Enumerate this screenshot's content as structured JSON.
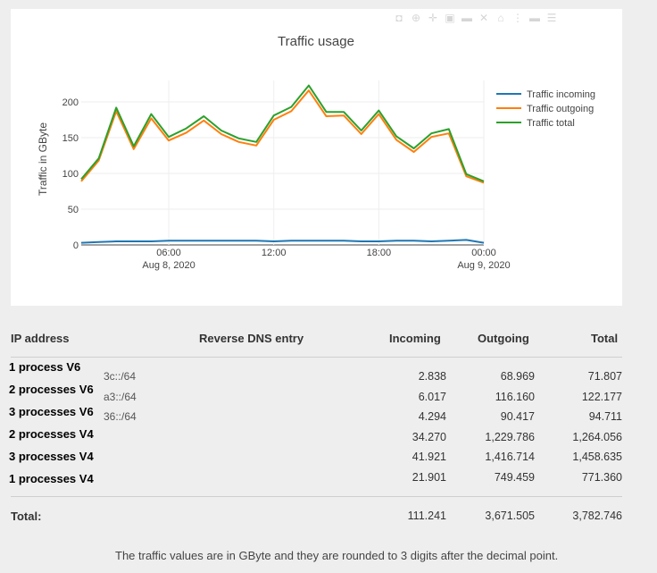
{
  "chart_data": {
    "type": "line",
    "title": "Traffic usage",
    "ylabel": "Traffic in GByte",
    "ylim": [
      0,
      230
    ],
    "yticks": [
      0,
      50,
      100,
      150,
      200
    ],
    "xlim": [
      "2020-08-08 01:00",
      "2020-08-09 00:00"
    ],
    "xticks": [
      {
        "x": "2020-08-08 06:00",
        "label": "06:00",
        "sublabel": "Aug 8, 2020"
      },
      {
        "x": "2020-08-08 12:00",
        "label": "12:00",
        "sublabel": ""
      },
      {
        "x": "2020-08-08 18:00",
        "label": "18:00",
        "sublabel": ""
      },
      {
        "x": "2020-08-09 00:00",
        "label": "00:00",
        "sublabel": "Aug 9, 2020"
      }
    ],
    "grid": true,
    "legend_position": "top-right",
    "x": [
      "2020-08-08 01:00",
      "2020-08-08 02:00",
      "2020-08-08 03:00",
      "2020-08-08 04:00",
      "2020-08-08 05:00",
      "2020-08-08 06:00",
      "2020-08-08 07:00",
      "2020-08-08 08:00",
      "2020-08-08 09:00",
      "2020-08-08 10:00",
      "2020-08-08 11:00",
      "2020-08-08 12:00",
      "2020-08-08 13:00",
      "2020-08-08 14:00",
      "2020-08-08 15:00",
      "2020-08-08 16:00",
      "2020-08-08 17:00",
      "2020-08-08 18:00",
      "2020-08-08 19:00",
      "2020-08-08 20:00",
      "2020-08-08 21:00",
      "2020-08-08 22:00",
      "2020-08-08 23:00",
      "2020-08-09 00:00"
    ],
    "series": [
      {
        "name": "Traffic incoming",
        "color": "#1f77b4",
        "values": [
          3,
          4,
          5,
          5,
          5,
          6,
          6,
          6,
          6,
          6,
          6,
          5,
          6,
          6,
          6,
          6,
          5,
          5,
          6,
          6,
          5,
          6,
          7,
          3
        ]
      },
      {
        "name": "Traffic outgoing",
        "color": "#ff7f0e",
        "values": [
          89,
          118,
          187,
          134,
          177,
          146,
          157,
          174,
          155,
          144,
          139,
          175,
          187,
          216,
          180,
          181,
          155,
          183,
          147,
          130,
          151,
          156,
          96,
          87
        ]
      },
      {
        "name": "Traffic total",
        "color": "#2ca02c",
        "values": [
          92,
          121,
          192,
          138,
          183,
          151,
          163,
          180,
          160,
          149,
          144,
          181,
          193,
          223,
          186,
          186,
          160,
          188,
          152,
          135,
          156,
          162,
          99,
          89
        ]
      }
    ]
  },
  "toolbar_icons": [
    "camera-icon",
    "zoom-icon",
    "pan-icon",
    "zoom-in-icon",
    "zoom-out-icon",
    "autoscale-icon",
    "home-icon",
    "spike-icon",
    "hover-closest-icon",
    "hover-compare-icon"
  ],
  "table": {
    "headers": {
      "ip": "IP address",
      "dns": "Reverse DNS entry",
      "incoming": "Incoming",
      "outgoing": "Outgoing",
      "total": "Total"
    },
    "rows": [
      {
        "label": "1 process V6",
        "dns": "3c::/64",
        "incoming": "2.838",
        "outgoing": "68.969",
        "total": "71.807"
      },
      {
        "label": "2 processes V6",
        "dns": "a3::/64",
        "incoming": "6.017",
        "outgoing": "116.160",
        "total": "122.177"
      },
      {
        "label": "3 processes V6",
        "dns": "36::/64",
        "incoming": "4.294",
        "outgoing": "90.417",
        "total": "94.711"
      },
      {
        "label": "2 processes V4",
        "dns": "",
        "incoming": "34.270",
        "outgoing": "1,229.786",
        "total": "1,264.056"
      },
      {
        "label": "3 processes V4",
        "dns": "",
        "incoming": "41.921",
        "outgoing": "1,416.714",
        "total": "1,458.635"
      },
      {
        "label": "1 processes V4",
        "dns": "",
        "incoming": "21.901",
        "outgoing": "749.459",
        "total": "771.360"
      }
    ],
    "total": {
      "label": "Total:",
      "incoming": "111.241",
      "outgoing": "3,671.505",
      "total": "3,782.746"
    }
  },
  "footnote": "The traffic values are in GByte and they are rounded to 3 digits after the decimal point."
}
